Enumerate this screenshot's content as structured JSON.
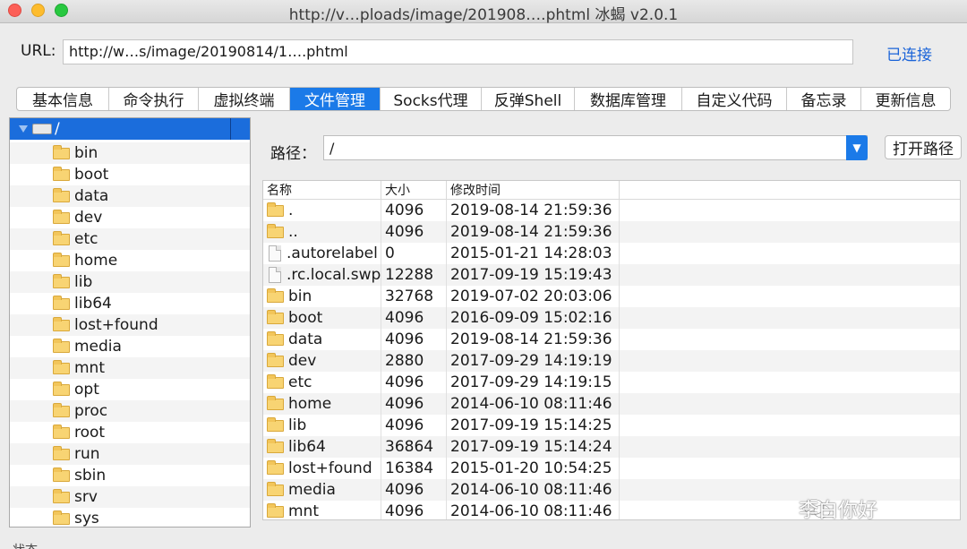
{
  "window": {
    "title": "http://v…ploads/image/201908….phtml   冰蝎 v2.0.1"
  },
  "url_bar": {
    "label": "URL:",
    "value": "http://w…s/image/20190814/1….phtml",
    "status": "已连接"
  },
  "tabs": [
    {
      "label": "基本信息"
    },
    {
      "label": "命令执行"
    },
    {
      "label": "虚拟终端"
    },
    {
      "label": "文件管理"
    },
    {
      "label": "Socks代理"
    },
    {
      "label": "反弹Shell"
    },
    {
      "label": "数据库管理"
    },
    {
      "label": "自定义代码"
    },
    {
      "label": "备忘录"
    },
    {
      "label": "更新信息"
    }
  ],
  "active_tab": "文件管理",
  "tree": {
    "root": "/",
    "items": [
      "bin",
      "boot",
      "data",
      "dev",
      "etc",
      "home",
      "lib",
      "lib64",
      "lost+found",
      "media",
      "mnt",
      "opt",
      "proc",
      "root",
      "run",
      "sbin",
      "srv",
      "sys"
    ]
  },
  "path_bar": {
    "label": "路径：",
    "value": "/",
    "open_button": "打开路径"
  },
  "file_table": {
    "columns": [
      "名称",
      "大小",
      "修改时间"
    ],
    "rows": [
      {
        "name": ".",
        "size": "4096",
        "modified": "2019-08-14 21:59:36",
        "icon": "folder-icon"
      },
      {
        "name": "..",
        "size": "4096",
        "modified": "2019-08-14 21:59:36",
        "icon": "folder-icon"
      },
      {
        "name": ".autorelabel",
        "size": "0",
        "modified": "2015-01-21 14:28:03",
        "icon": "file-icon"
      },
      {
        "name": ".rc.local.swp",
        "size": "12288",
        "modified": "2017-09-19 15:19:43",
        "icon": "file-icon"
      },
      {
        "name": "bin",
        "size": "32768",
        "modified": "2019-07-02 20:03:06",
        "icon": "folder-icon"
      },
      {
        "name": "boot",
        "size": "4096",
        "modified": "2016-09-09 15:02:16",
        "icon": "folder-icon"
      },
      {
        "name": "data",
        "size": "4096",
        "modified": "2019-08-14 21:59:36",
        "icon": "folder-icon"
      },
      {
        "name": "dev",
        "size": "2880",
        "modified": "2017-09-29 14:19:19",
        "icon": "folder-icon"
      },
      {
        "name": "etc",
        "size": "4096",
        "modified": "2017-09-29 14:19:15",
        "icon": "folder-icon"
      },
      {
        "name": "home",
        "size": "4096",
        "modified": "2014-06-10 08:11:46",
        "icon": "folder-icon"
      },
      {
        "name": "lib",
        "size": "4096",
        "modified": "2017-09-19 15:14:25",
        "icon": "folder-icon"
      },
      {
        "name": "lib64",
        "size": "36864",
        "modified": "2017-09-19 15:14:24",
        "icon": "folder-icon"
      },
      {
        "name": "lost+found",
        "size": "16384",
        "modified": "2015-01-20 10:54:25",
        "icon": "folder-icon"
      },
      {
        "name": "media",
        "size": "4096",
        "modified": "2014-06-10 08:11:46",
        "icon": "folder-icon"
      },
      {
        "name": "mnt",
        "size": "4096",
        "modified": "2014-06-10 08:11:46",
        "icon": "folder-icon"
      }
    ]
  },
  "status_bar": {
    "label": "状态"
  },
  "watermark": {
    "text": "李白你好"
  },
  "colors": {
    "accent": "#1b7ae8",
    "selection": "#1b6ddc",
    "link": "#1a63d8",
    "folder": "#f8d473"
  }
}
